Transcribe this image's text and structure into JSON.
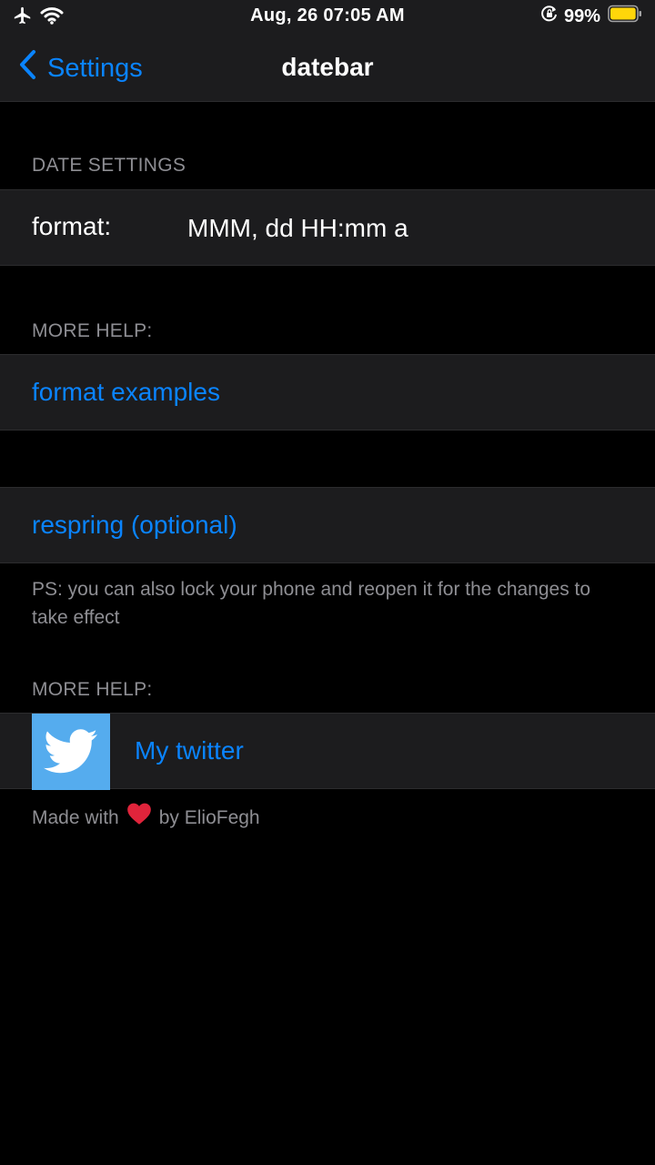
{
  "status_bar": {
    "time": "Aug, 26 07:05 AM",
    "battery_percent": "99%",
    "battery_level": 0.99,
    "icons": [
      "airplane-icon",
      "wifi-icon",
      "rotation-lock-icon",
      "battery-icon"
    ]
  },
  "nav": {
    "back_label": "Settings",
    "title": "datebar"
  },
  "date_settings": {
    "header": "DATE SETTINGS",
    "format_label": "format:",
    "format_value": "MMM, dd HH:mm a"
  },
  "help": {
    "header": "MORE HELP:",
    "format_examples": "format examples"
  },
  "respring": {
    "label": "respring (optional)",
    "footer": "PS: you can also lock your phone and reopen it for the changes to take effect"
  },
  "social": {
    "header": "MORE HELP:",
    "twitter_label": "My twitter",
    "made_with_prefix": "Made with",
    "made_with_suffix": "by ElioFegh"
  },
  "colors": {
    "accent": "#0a84ff",
    "cell_background": "#1c1c1e",
    "secondary_text": "#8e8e93",
    "twitter_blue": "#55acee",
    "battery": "#ffd60a"
  }
}
